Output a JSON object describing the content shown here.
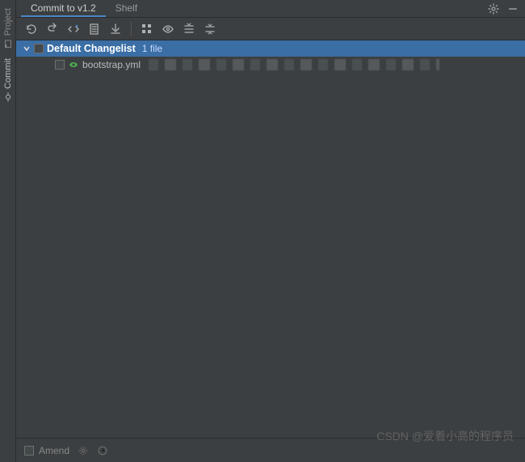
{
  "leftTabs": {
    "project": "Project",
    "commit": "Commit"
  },
  "tabs": {
    "commit": "Commit to v1.2",
    "shelf": "Shelf"
  },
  "toolbarIcons": {
    "refresh": "refresh-icon",
    "revert": "revert-icon",
    "diff": "diff-icon",
    "changelist": "changelist-icon",
    "shelve": "shelve-icon",
    "group": "group-by-icon",
    "preview": "preview-icon",
    "expand": "expand-all-icon",
    "collapse": "collapse-all-icon"
  },
  "topIcons": {
    "settings": "gear-icon",
    "hide": "minimize-icon"
  },
  "changelist": {
    "name": "Default Changelist",
    "count": "1 file"
  },
  "files": [
    {
      "icon": "yaml-file-icon",
      "name": "bootstrap.yml"
    }
  ],
  "bottom": {
    "amend": "Amend"
  },
  "watermark": "CSDN @爱着小高的程序员"
}
